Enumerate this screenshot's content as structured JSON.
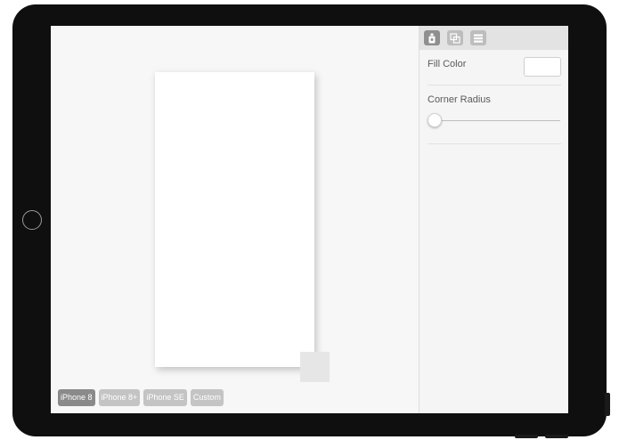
{
  "canvas": {
    "device_presets": [
      {
        "label": "iPhone 8",
        "selected": true
      },
      {
        "label": "iPhone 8+",
        "selected": false
      },
      {
        "label": "iPhone SE",
        "selected": false
      },
      {
        "label": "Custom",
        "selected": false
      }
    ],
    "artboard_fill": "#ffffff"
  },
  "inspector": {
    "toolbar": [
      {
        "icon": "style-icon",
        "active": true
      },
      {
        "icon": "layout-icon",
        "active": false
      },
      {
        "icon": "layers-icon",
        "active": false
      }
    ],
    "fill_color": {
      "label": "Fill Color",
      "value": "#ffffff"
    },
    "corner_radius": {
      "label": "Corner Radius",
      "value": 0
    }
  }
}
